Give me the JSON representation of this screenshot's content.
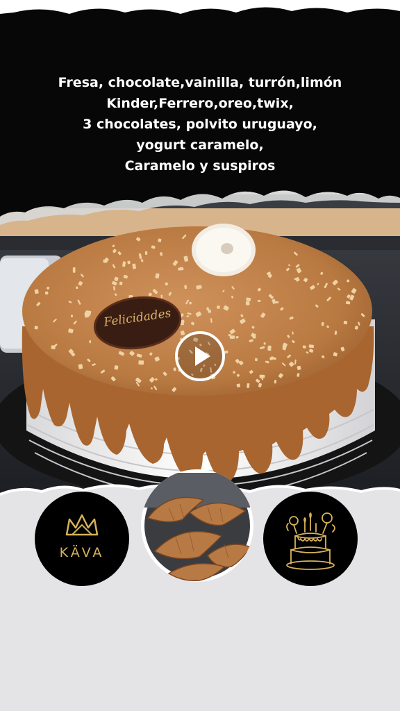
{
  "banner": {
    "lines": [
      "Fresa, chocolate,vainilla, turrón,limón",
      "Kinder,Ferrero,oreo,twix,",
      "3 chocolates, polvito uruguayo,",
      "yogurt caramelo,",
      "Caramelo y suspiros"
    ]
  },
  "cake": {
    "plaque_text": "Felicidades"
  },
  "video": {
    "play_icon": "play-icon"
  },
  "brands": {
    "left_logo_text": "KÄVA",
    "left_logo_icon": "crown-icon",
    "right_logo_icon": "cake-icon",
    "center_image_icon": "croissant-icon"
  },
  "colors": {
    "banner_bg": "#060606",
    "page_bg": "#e4e3e6",
    "caramel": "#b9743c",
    "gold": "#d8b25a"
  }
}
